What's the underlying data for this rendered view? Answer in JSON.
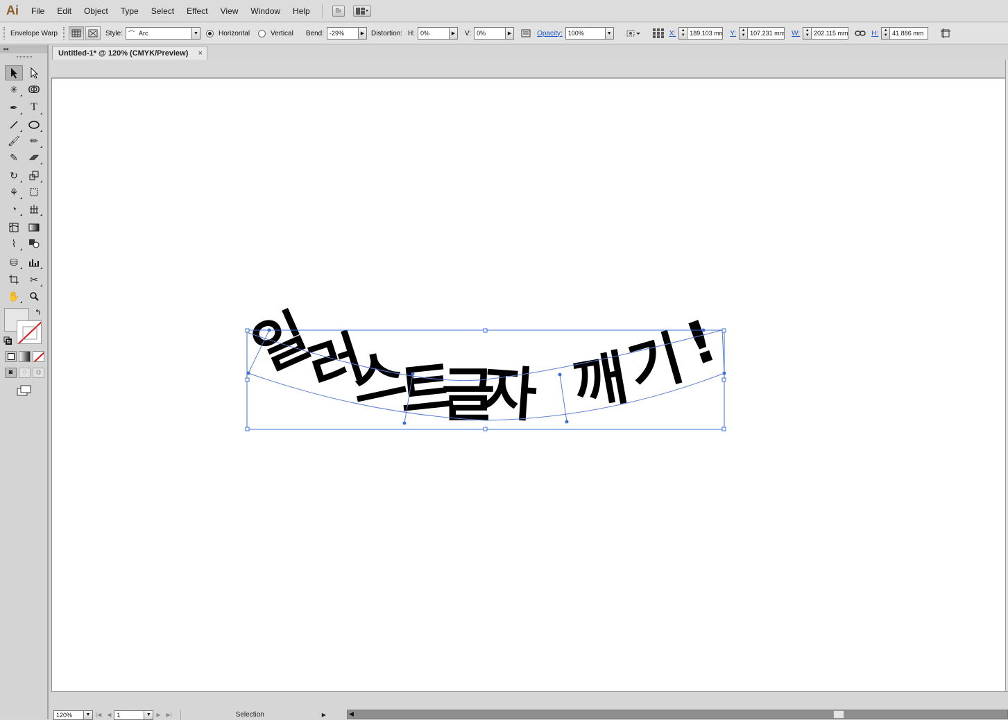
{
  "app": {
    "logo": "Ai",
    "menus": [
      "File",
      "Edit",
      "Object",
      "Type",
      "Select",
      "Effect",
      "View",
      "Window",
      "Help"
    ],
    "bridge_label": "Br",
    "workspace_icon": "arrange-documents-icon"
  },
  "control_bar": {
    "mode_label": "Envelope Warp",
    "style_label": "Style:",
    "style_value": "Arc",
    "horizontal_label": "Horizontal",
    "vertical_label": "Vertical",
    "orientation_selected": "Horizontal",
    "bend_label": "Bend:",
    "bend_value": "-29%",
    "distortion_label": "Distortion:",
    "h_label": "H:",
    "h_value": "0%",
    "v_label": "V:",
    "v_value": "0%",
    "opacity_label": "Opacity:",
    "opacity_value": "100%",
    "x_label": "X:",
    "x_value": "189.103 mm",
    "y_label": "Y:",
    "y_value": "107.231 mm",
    "w_label": "W:",
    "w_value": "202.115 mm",
    "hh_label": "H:",
    "hh_value": "41.886 mm"
  },
  "document": {
    "tab_title": "Untitled-1* @ 120% (CMYK/Preview)",
    "close_glyph": "×",
    "artwork_text": [
      "일",
      "러",
      "스",
      "트",
      "글",
      "자",
      " ",
      "깨",
      "기",
      "!"
    ],
    "selection_color": "#3d6fd6"
  },
  "toolbox": {
    "tools": [
      [
        "selection-tool",
        "direct-selection-tool"
      ],
      [
        "magic-wand-tool",
        "lasso-tool"
      ],
      [
        "pen-tool",
        "type-tool"
      ],
      [
        "line-segment-tool",
        "ellipse-tool"
      ],
      [
        "paintbrush-tool",
        "pencil-tool"
      ],
      [
        "blob-brush-tool",
        "eraser-tool"
      ],
      [
        "rotate-tool",
        "scale-tool"
      ],
      [
        "warp-tool",
        "free-transform-tool"
      ],
      [
        "shape-builder-tool",
        "perspective-grid-tool"
      ],
      [
        "mesh-tool",
        "gradient-tool"
      ],
      [
        "eyedropper-tool",
        "blend-tool"
      ],
      [
        "symbol-sprayer-tool",
        "column-graph-tool"
      ],
      [
        "artboard-tool",
        "slice-tool"
      ],
      [
        "hand-tool",
        "zoom-tool"
      ]
    ],
    "selected_tool": "selection-tool"
  },
  "status": {
    "zoom": "120%",
    "page": "1",
    "current_tool": "Selection"
  }
}
